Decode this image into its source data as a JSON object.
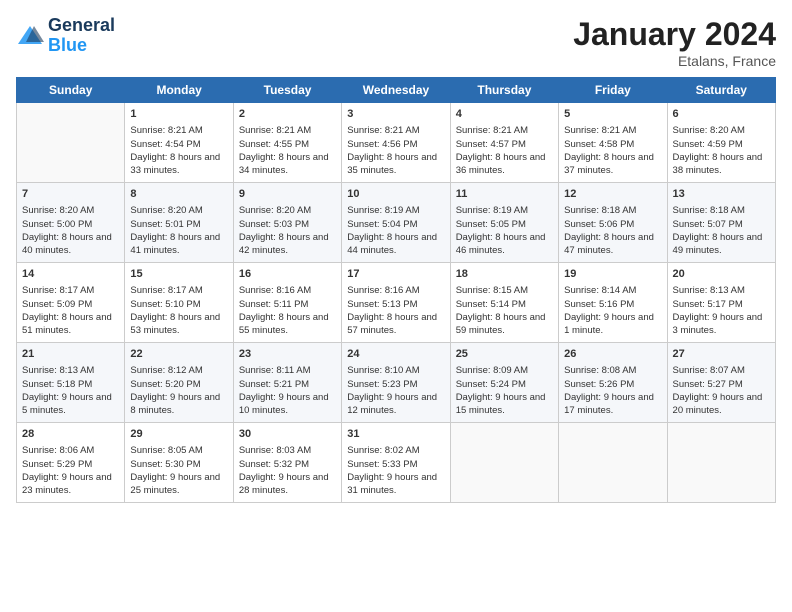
{
  "header": {
    "logo_line1": "General",
    "logo_line2": "Blue",
    "month": "January 2024",
    "location": "Etalans, France"
  },
  "columns": [
    "Sunday",
    "Monday",
    "Tuesday",
    "Wednesday",
    "Thursday",
    "Friday",
    "Saturday"
  ],
  "weeks": [
    [
      {
        "day": "",
        "sunrise": "",
        "sunset": "",
        "daylight": ""
      },
      {
        "day": "1",
        "sunrise": "Sunrise: 8:21 AM",
        "sunset": "Sunset: 4:54 PM",
        "daylight": "Daylight: 8 hours and 33 minutes."
      },
      {
        "day": "2",
        "sunrise": "Sunrise: 8:21 AM",
        "sunset": "Sunset: 4:55 PM",
        "daylight": "Daylight: 8 hours and 34 minutes."
      },
      {
        "day": "3",
        "sunrise": "Sunrise: 8:21 AM",
        "sunset": "Sunset: 4:56 PM",
        "daylight": "Daylight: 8 hours and 35 minutes."
      },
      {
        "day": "4",
        "sunrise": "Sunrise: 8:21 AM",
        "sunset": "Sunset: 4:57 PM",
        "daylight": "Daylight: 8 hours and 36 minutes."
      },
      {
        "day": "5",
        "sunrise": "Sunrise: 8:21 AM",
        "sunset": "Sunset: 4:58 PM",
        "daylight": "Daylight: 8 hours and 37 minutes."
      },
      {
        "day": "6",
        "sunrise": "Sunrise: 8:20 AM",
        "sunset": "Sunset: 4:59 PM",
        "daylight": "Daylight: 8 hours and 38 minutes."
      }
    ],
    [
      {
        "day": "7",
        "sunrise": "Sunrise: 8:20 AM",
        "sunset": "Sunset: 5:00 PM",
        "daylight": "Daylight: 8 hours and 40 minutes."
      },
      {
        "day": "8",
        "sunrise": "Sunrise: 8:20 AM",
        "sunset": "Sunset: 5:01 PM",
        "daylight": "Daylight: 8 hours and 41 minutes."
      },
      {
        "day": "9",
        "sunrise": "Sunrise: 8:20 AM",
        "sunset": "Sunset: 5:03 PM",
        "daylight": "Daylight: 8 hours and 42 minutes."
      },
      {
        "day": "10",
        "sunrise": "Sunrise: 8:19 AM",
        "sunset": "Sunset: 5:04 PM",
        "daylight": "Daylight: 8 hours and 44 minutes."
      },
      {
        "day": "11",
        "sunrise": "Sunrise: 8:19 AM",
        "sunset": "Sunset: 5:05 PM",
        "daylight": "Daylight: 8 hours and 46 minutes."
      },
      {
        "day": "12",
        "sunrise": "Sunrise: 8:18 AM",
        "sunset": "Sunset: 5:06 PM",
        "daylight": "Daylight: 8 hours and 47 minutes."
      },
      {
        "day": "13",
        "sunrise": "Sunrise: 8:18 AM",
        "sunset": "Sunset: 5:07 PM",
        "daylight": "Daylight: 8 hours and 49 minutes."
      }
    ],
    [
      {
        "day": "14",
        "sunrise": "Sunrise: 8:17 AM",
        "sunset": "Sunset: 5:09 PM",
        "daylight": "Daylight: 8 hours and 51 minutes."
      },
      {
        "day": "15",
        "sunrise": "Sunrise: 8:17 AM",
        "sunset": "Sunset: 5:10 PM",
        "daylight": "Daylight: 8 hours and 53 minutes."
      },
      {
        "day": "16",
        "sunrise": "Sunrise: 8:16 AM",
        "sunset": "Sunset: 5:11 PM",
        "daylight": "Daylight: 8 hours and 55 minutes."
      },
      {
        "day": "17",
        "sunrise": "Sunrise: 8:16 AM",
        "sunset": "Sunset: 5:13 PM",
        "daylight": "Daylight: 8 hours and 57 minutes."
      },
      {
        "day": "18",
        "sunrise": "Sunrise: 8:15 AM",
        "sunset": "Sunset: 5:14 PM",
        "daylight": "Daylight: 8 hours and 59 minutes."
      },
      {
        "day": "19",
        "sunrise": "Sunrise: 8:14 AM",
        "sunset": "Sunset: 5:16 PM",
        "daylight": "Daylight: 9 hours and 1 minute."
      },
      {
        "day": "20",
        "sunrise": "Sunrise: 8:13 AM",
        "sunset": "Sunset: 5:17 PM",
        "daylight": "Daylight: 9 hours and 3 minutes."
      }
    ],
    [
      {
        "day": "21",
        "sunrise": "Sunrise: 8:13 AM",
        "sunset": "Sunset: 5:18 PM",
        "daylight": "Daylight: 9 hours and 5 minutes."
      },
      {
        "day": "22",
        "sunrise": "Sunrise: 8:12 AM",
        "sunset": "Sunset: 5:20 PM",
        "daylight": "Daylight: 9 hours and 8 minutes."
      },
      {
        "day": "23",
        "sunrise": "Sunrise: 8:11 AM",
        "sunset": "Sunset: 5:21 PM",
        "daylight": "Daylight: 9 hours and 10 minutes."
      },
      {
        "day": "24",
        "sunrise": "Sunrise: 8:10 AM",
        "sunset": "Sunset: 5:23 PM",
        "daylight": "Daylight: 9 hours and 12 minutes."
      },
      {
        "day": "25",
        "sunrise": "Sunrise: 8:09 AM",
        "sunset": "Sunset: 5:24 PM",
        "daylight": "Daylight: 9 hours and 15 minutes."
      },
      {
        "day": "26",
        "sunrise": "Sunrise: 8:08 AM",
        "sunset": "Sunset: 5:26 PM",
        "daylight": "Daylight: 9 hours and 17 minutes."
      },
      {
        "day": "27",
        "sunrise": "Sunrise: 8:07 AM",
        "sunset": "Sunset: 5:27 PM",
        "daylight": "Daylight: 9 hours and 20 minutes."
      }
    ],
    [
      {
        "day": "28",
        "sunrise": "Sunrise: 8:06 AM",
        "sunset": "Sunset: 5:29 PM",
        "daylight": "Daylight: 9 hours and 23 minutes."
      },
      {
        "day": "29",
        "sunrise": "Sunrise: 8:05 AM",
        "sunset": "Sunset: 5:30 PM",
        "daylight": "Daylight: 9 hours and 25 minutes."
      },
      {
        "day": "30",
        "sunrise": "Sunrise: 8:03 AM",
        "sunset": "Sunset: 5:32 PM",
        "daylight": "Daylight: 9 hours and 28 minutes."
      },
      {
        "day": "31",
        "sunrise": "Sunrise: 8:02 AM",
        "sunset": "Sunset: 5:33 PM",
        "daylight": "Daylight: 9 hours and 31 minutes."
      },
      {
        "day": "",
        "sunrise": "",
        "sunset": "",
        "daylight": ""
      },
      {
        "day": "",
        "sunrise": "",
        "sunset": "",
        "daylight": ""
      },
      {
        "day": "",
        "sunrise": "",
        "sunset": "",
        "daylight": ""
      }
    ]
  ]
}
